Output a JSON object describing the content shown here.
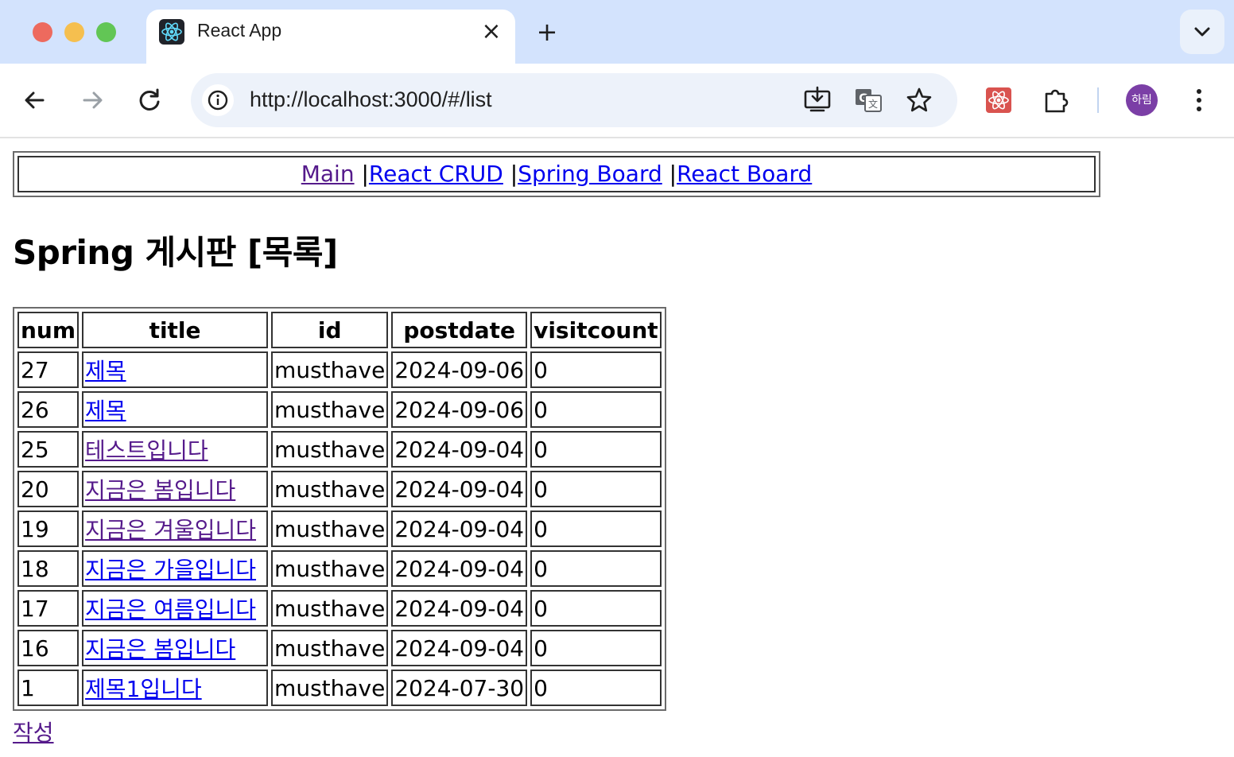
{
  "browser": {
    "tab_title": "React App",
    "url": "http://localhost:3000/#/list",
    "profile_label": "하림"
  },
  "nav": {
    "items": [
      {
        "label": "Main",
        "visited": true
      },
      {
        "label": "React CRUD",
        "visited": false
      },
      {
        "label": "Spring Board",
        "visited": false
      },
      {
        "label": "React Board",
        "visited": false
      }
    ],
    "separator": "|"
  },
  "page": {
    "title": "Spring 게시판 [목록]"
  },
  "table": {
    "headers": [
      "num",
      "title",
      "id",
      "postdate",
      "visitcount"
    ],
    "rows": [
      {
        "num": "27",
        "title": "제목",
        "id": "musthave",
        "postdate": "2024-09-06",
        "visitcount": "0",
        "visited": false
      },
      {
        "num": "26",
        "title": "제목",
        "id": "musthave",
        "postdate": "2024-09-06",
        "visitcount": "0",
        "visited": false
      },
      {
        "num": "25",
        "title": "테스트입니다",
        "id": "musthave",
        "postdate": "2024-09-04",
        "visitcount": "0",
        "visited": true
      },
      {
        "num": "20",
        "title": "지금은 봄입니다",
        "id": "musthave",
        "postdate": "2024-09-04",
        "visitcount": "0",
        "visited": true
      },
      {
        "num": "19",
        "title": "지금은 겨울입니다",
        "id": "musthave",
        "postdate": "2024-09-04",
        "visitcount": "0",
        "visited": true
      },
      {
        "num": "18",
        "title": "지금은 가을입니다",
        "id": "musthave",
        "postdate": "2024-09-04",
        "visitcount": "0",
        "visited": false
      },
      {
        "num": "17",
        "title": "지금은 여름입니다",
        "id": "musthave",
        "postdate": "2024-09-04",
        "visitcount": "0",
        "visited": false
      },
      {
        "num": "16",
        "title": "지금은 봄입니다",
        "id": "musthave",
        "postdate": "2024-09-04",
        "visitcount": "0",
        "visited": false
      },
      {
        "num": "1",
        "title": "제목1입니다",
        "id": "musthave",
        "postdate": "2024-07-30",
        "visitcount": "0",
        "visited": false
      }
    ]
  },
  "write_link": {
    "label": "작성",
    "visited": true
  },
  "colors": {
    "link": "#0000ee",
    "visited_link": "#551a8b",
    "tabstrip": "#d3e3fd"
  },
  "icons": [
    "react-favicon-icon",
    "close-icon",
    "plus-icon",
    "chevron-down-icon",
    "back-arrow-icon",
    "forward-arrow-icon",
    "reload-icon",
    "info-icon",
    "install-app-icon",
    "translate-icon",
    "bookmark-star-icon",
    "react-devtools-icon",
    "extensions-puzzle-icon",
    "kebab-menu-icon"
  ]
}
